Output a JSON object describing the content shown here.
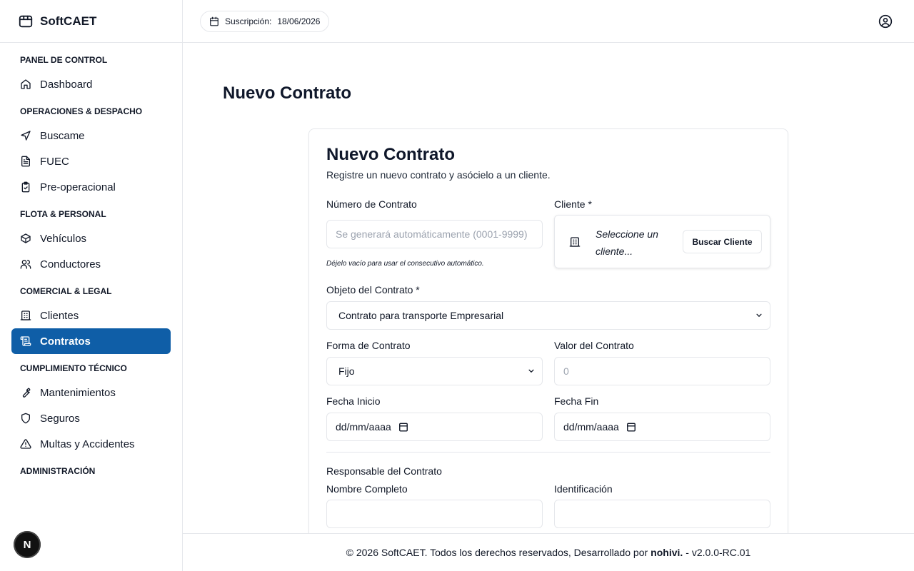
{
  "app": {
    "name": "SoftCAET"
  },
  "header": {
    "subscription_label": "Suscripción:",
    "subscription_date": "18/06/2026"
  },
  "sidebar": {
    "groups": [
      {
        "label": "PANEL DE CONTROL",
        "items": [
          "Dashboard"
        ]
      },
      {
        "label": "OPERACIONES & DESPACHO",
        "items": [
          "Buscame",
          "FUEC",
          "Pre-operacional"
        ]
      },
      {
        "label": "FLOTA & PERSONAL",
        "items": [
          "Vehículos",
          "Conductores"
        ]
      },
      {
        "label": "COMERCIAL & LEGAL",
        "items": [
          "Clientes",
          "Contratos"
        ]
      },
      {
        "label": "CUMPLIMIENTO TÉCNICO",
        "items": [
          "Mantenimientos",
          "Seguros",
          "Multas y Accidentes"
        ]
      },
      {
        "label": "ADMINISTRACIÓN",
        "items": []
      }
    ],
    "active_item": "Contratos",
    "badge": "N"
  },
  "page": {
    "title": "Nuevo Contrato"
  },
  "form": {
    "title": "Nuevo Contrato",
    "subtitle": "Registre un nuevo contrato y asócielo a un cliente.",
    "numero_label": "Número de Contrato",
    "numero_placeholder": "Se generará automáticamente (0001-9999)",
    "numero_hint": "Déjelo vacío para usar el consecutivo automático.",
    "cliente_label": "Cliente *",
    "cliente_value": "Seleccione un cliente...",
    "buscar_cliente": "Buscar Cliente",
    "objeto_label": "Objeto del Contrato *",
    "objeto_value": "Contrato para transporte Empresarial",
    "forma_label": "Forma de Contrato",
    "forma_value": "Fijo",
    "valor_label": "Valor del Contrato",
    "valor_placeholder": "0",
    "fecha_inicio_label": "Fecha Inicio",
    "fecha_inicio_value": "dd/mm/aaaa",
    "fecha_fin_label": "Fecha Fin",
    "fecha_fin_value": "dd/mm/aaaa",
    "responsable_heading": "Responsable del Contrato",
    "nombre_label": "Nombre Completo",
    "identificacion_label": "Identificación"
  },
  "footer": {
    "prefix": "© 2026 SoftCAET. Todos los derechos reservados, Desarrollado por",
    "author": "nohivi.",
    "version": "- v2.0.0-RC.01"
  }
}
